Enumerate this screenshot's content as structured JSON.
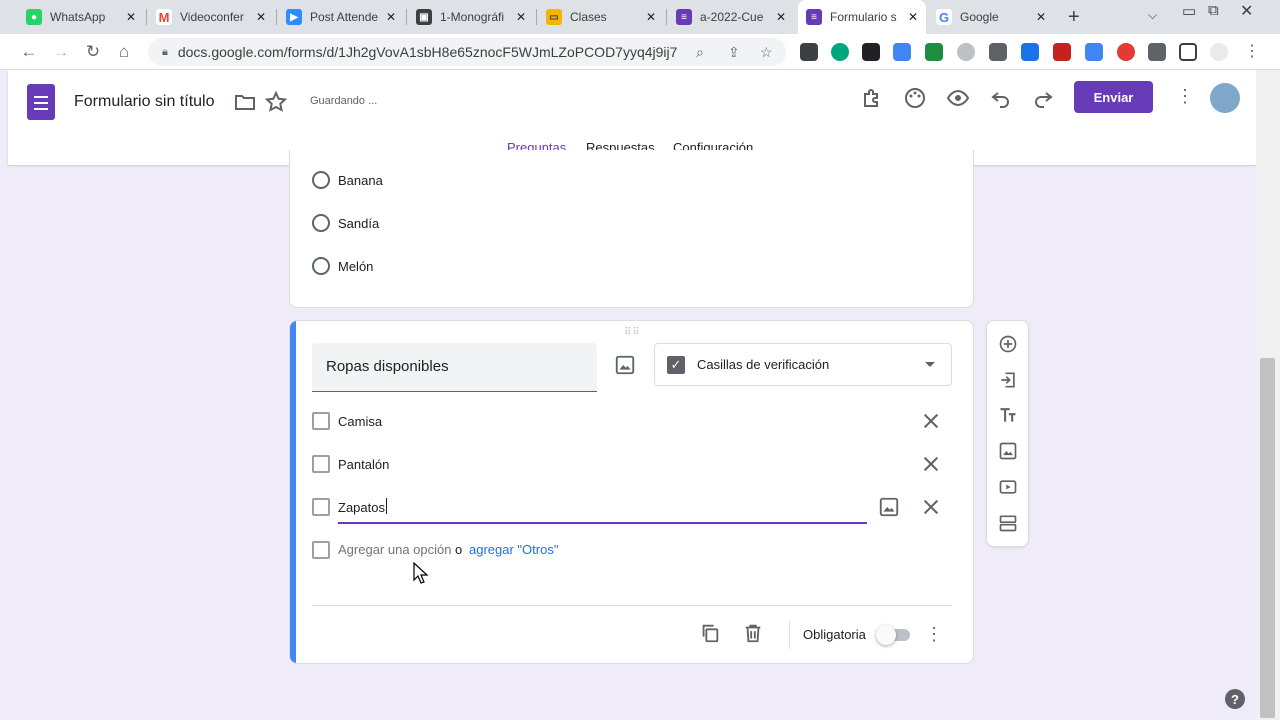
{
  "browser": {
    "tabs": [
      {
        "label": "WhatsApp",
        "icon": "whatsapp-icon",
        "color": "#25d366"
      },
      {
        "label": "Videoconfer",
        "icon": "gmail-icon",
        "color": "#ea4335"
      },
      {
        "label": "Post Attende",
        "icon": "zoom-icon",
        "color": "#2d8cff"
      },
      {
        "label": "1-Monográfi",
        "icon": "classroom-icon",
        "color": "#3c4043"
      },
      {
        "label": "Clases",
        "icon": "slides-icon",
        "color": "#f4b400"
      },
      {
        "label": "a-2022-Cue",
        "icon": "forms-icon",
        "color": "#673ab7"
      },
      {
        "label": "Formulario s",
        "icon": "forms-icon",
        "color": "#673ab7"
      },
      {
        "label": "Google",
        "icon": "google-icon",
        "color": "#4285f4"
      }
    ],
    "url": "docs.google.com/forms/d/1Jh2gVovA1sbH8e65znocF5WJmLZoPCOD7yyq4j9ij78..."
  },
  "header": {
    "title": "Formulario sin título",
    "saving": "Guardando ...",
    "send_label": "Enviar"
  },
  "form_tabs": [
    "Preguntas",
    "Respuestas",
    "Configuración"
  ],
  "previous_question": {
    "options": [
      "Banana",
      "Sandía",
      "Melón"
    ]
  },
  "active_question": {
    "title": "Ropas disponibles",
    "type_label": "Casillas de verificación",
    "options": [
      "Camisa",
      "Pantalón",
      "Zapatos"
    ],
    "add_option": "Agregar una opción",
    "or": "o",
    "add_other": "agregar \"Otros\"",
    "required_label": "Obligatoria",
    "required": false
  },
  "colors": {
    "accent": "#673ab7",
    "active_bar": "#4285f4",
    "background": "#f0ebf8"
  }
}
